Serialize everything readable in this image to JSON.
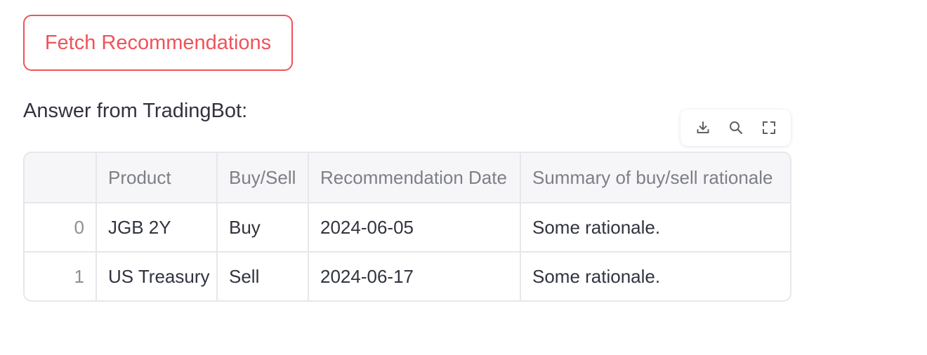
{
  "button": {
    "fetch_label": "Fetch Recommendations"
  },
  "answer": {
    "label": "Answer from TradingBot:"
  },
  "toolbar": {
    "icons": [
      "download-icon",
      "search-icon",
      "fullscreen-icon"
    ]
  },
  "table": {
    "columns": [
      "",
      "Product",
      "Buy/Sell",
      "Recommendation Date",
      "Summary of buy/sell rationale"
    ],
    "rows": [
      {
        "index": "0",
        "product": "JGB 2Y",
        "action": "Buy",
        "date": "2024-06-05",
        "summary": "Some rationale."
      },
      {
        "index": "1",
        "product": "US Treasury",
        "action": "Sell",
        "date": "2024-06-17",
        "summary": "Some rationale."
      }
    ]
  },
  "colors": {
    "accent": "#f0525a",
    "text": "#31333f",
    "header_text": "#7d7f87",
    "border": "#e6e7ea",
    "header_bg": "#f6f6f8"
  }
}
